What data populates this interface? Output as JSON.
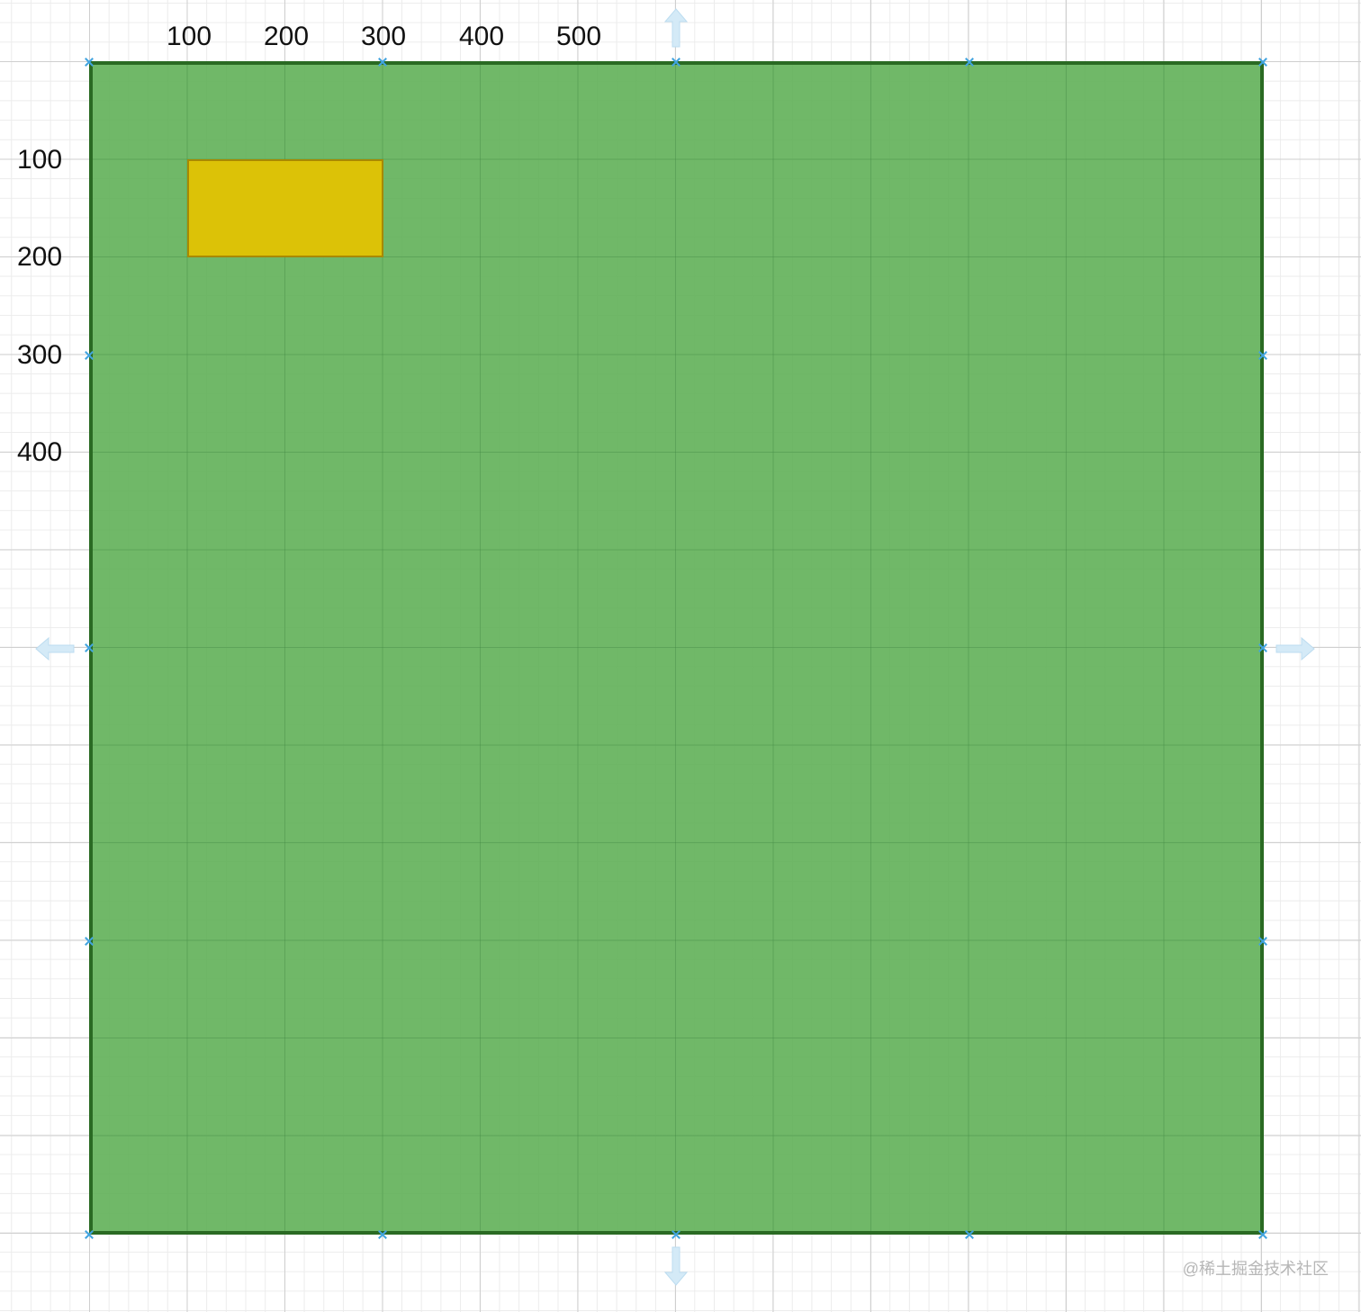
{
  "ruler": {
    "x_labels": [
      "100",
      "200",
      "300",
      "400",
      "500"
    ],
    "y_labels": [
      "100",
      "200",
      "300",
      "400"
    ]
  },
  "shapes": {
    "container_fill": "#6cb867",
    "container_stroke": "#2a6a23",
    "inner_rect_fill": "#dcc207",
    "inner_rect_stroke": "#a88900"
  },
  "icons": {
    "connection_handle": "x-marker-icon",
    "arrows": [
      "arrow-up-icon",
      "arrow-down-icon",
      "arrow-left-icon",
      "arrow-right-icon"
    ]
  },
  "watermark": "@稀土掘金技术社区"
}
